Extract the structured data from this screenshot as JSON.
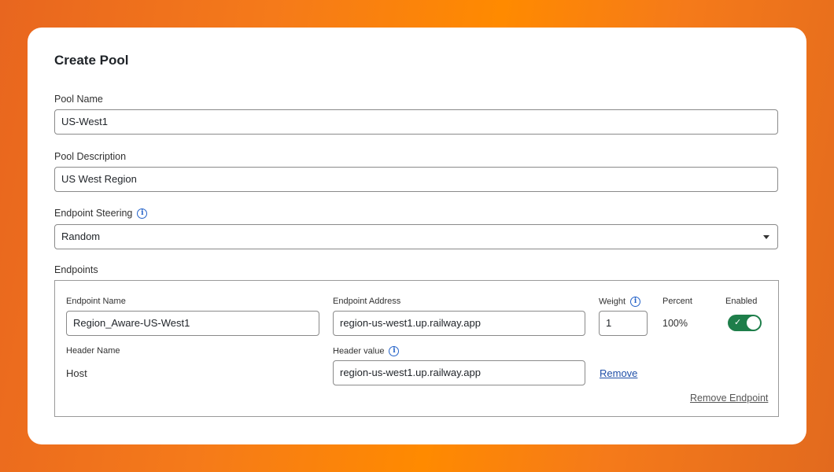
{
  "title": "Create Pool",
  "pool_name": {
    "label": "Pool Name",
    "value": "US-West1"
  },
  "pool_description": {
    "label": "Pool Description",
    "value": "US West Region"
  },
  "endpoint_steering": {
    "label": "Endpoint Steering",
    "value": "Random",
    "info_icon": "info-icon"
  },
  "endpoints": {
    "label": "Endpoints",
    "columns": {
      "name": "Endpoint Name",
      "address": "Endpoint Address",
      "weight": "Weight",
      "percent": "Percent",
      "enabled": "Enabled",
      "header_name": "Header Name",
      "header_value": "Header value"
    },
    "item": {
      "name": "Region_Aware-US-West1",
      "address": "region-us-west1.up.railway.app",
      "weight": "1",
      "percent": "100%",
      "enabled": true,
      "header_name": "Host",
      "header_value": "region-us-west1.up.railway.app",
      "remove_label": "Remove"
    },
    "remove_endpoint_label": "Remove Endpoint"
  },
  "colors": {
    "toggle_on": "#1e7e4a",
    "link": "#1f4fa8",
    "info": "#2563c9"
  }
}
